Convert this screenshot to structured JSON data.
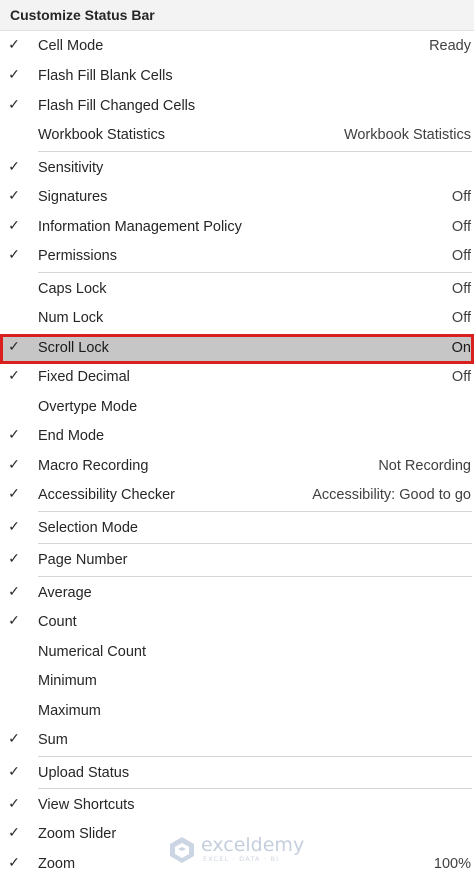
{
  "menu": {
    "title": "Customize Status Bar",
    "items": [
      {
        "label": "Cell Mode",
        "value": "Ready",
        "checked": true
      },
      {
        "label": "Flash Fill Blank Cells",
        "value": "",
        "checked": true
      },
      {
        "label": "Flash Fill Changed Cells",
        "value": "",
        "checked": true
      },
      {
        "label": "Workbook Statistics",
        "value": "Workbook Statistics",
        "checked": false
      },
      {
        "label": "Sensitivity",
        "value": "",
        "checked": true
      },
      {
        "label": "Signatures",
        "value": "Off",
        "checked": true
      },
      {
        "label": "Information Management Policy",
        "value": "Off",
        "checked": true
      },
      {
        "label": "Permissions",
        "value": "Off",
        "checked": true
      },
      {
        "label": "Caps Lock",
        "value": "Off",
        "checked": false
      },
      {
        "label": "Num Lock",
        "value": "Off",
        "checked": false
      },
      {
        "label": "Scroll Lock",
        "value": "On",
        "checked": true
      },
      {
        "label": "Fixed Decimal",
        "value": "Off",
        "checked": true
      },
      {
        "label": "Overtype Mode",
        "value": "",
        "checked": false
      },
      {
        "label": "End Mode",
        "value": "",
        "checked": true
      },
      {
        "label": "Macro Recording",
        "value": "Not Recording",
        "checked": true
      },
      {
        "label": "Accessibility Checker",
        "value": "Accessibility: Good to go",
        "checked": true
      },
      {
        "label": "Selection Mode",
        "value": "",
        "checked": true
      },
      {
        "label": "Page Number",
        "value": "",
        "checked": true
      },
      {
        "label": "Average",
        "value": "",
        "checked": true
      },
      {
        "label": "Count",
        "value": "",
        "checked": true
      },
      {
        "label": "Numerical Count",
        "value": "",
        "checked": false
      },
      {
        "label": "Minimum",
        "value": "",
        "checked": false
      },
      {
        "label": "Maximum",
        "value": "",
        "checked": false
      },
      {
        "label": "Sum",
        "value": "",
        "checked": true
      },
      {
        "label": "Upload Status",
        "value": "",
        "checked": true
      },
      {
        "label": "View Shortcuts",
        "value": "",
        "checked": true
      },
      {
        "label": "Zoom Slider",
        "value": "",
        "checked": true
      },
      {
        "label": "Zoom",
        "value": "100%",
        "checked": true
      }
    ],
    "highlighted_item": "Scroll Lock"
  },
  "watermark": {
    "name": "exceldemy",
    "tagline": "EXCEL · DATA · BI",
    "icon": "exceldemy-logo-icon"
  },
  "icons": {
    "check": "checkmark-icon"
  },
  "colors": {
    "highlight_fill": "#c6c6c6",
    "highlight_border": "#d9201f",
    "header_bg": "#f3f3f3"
  }
}
